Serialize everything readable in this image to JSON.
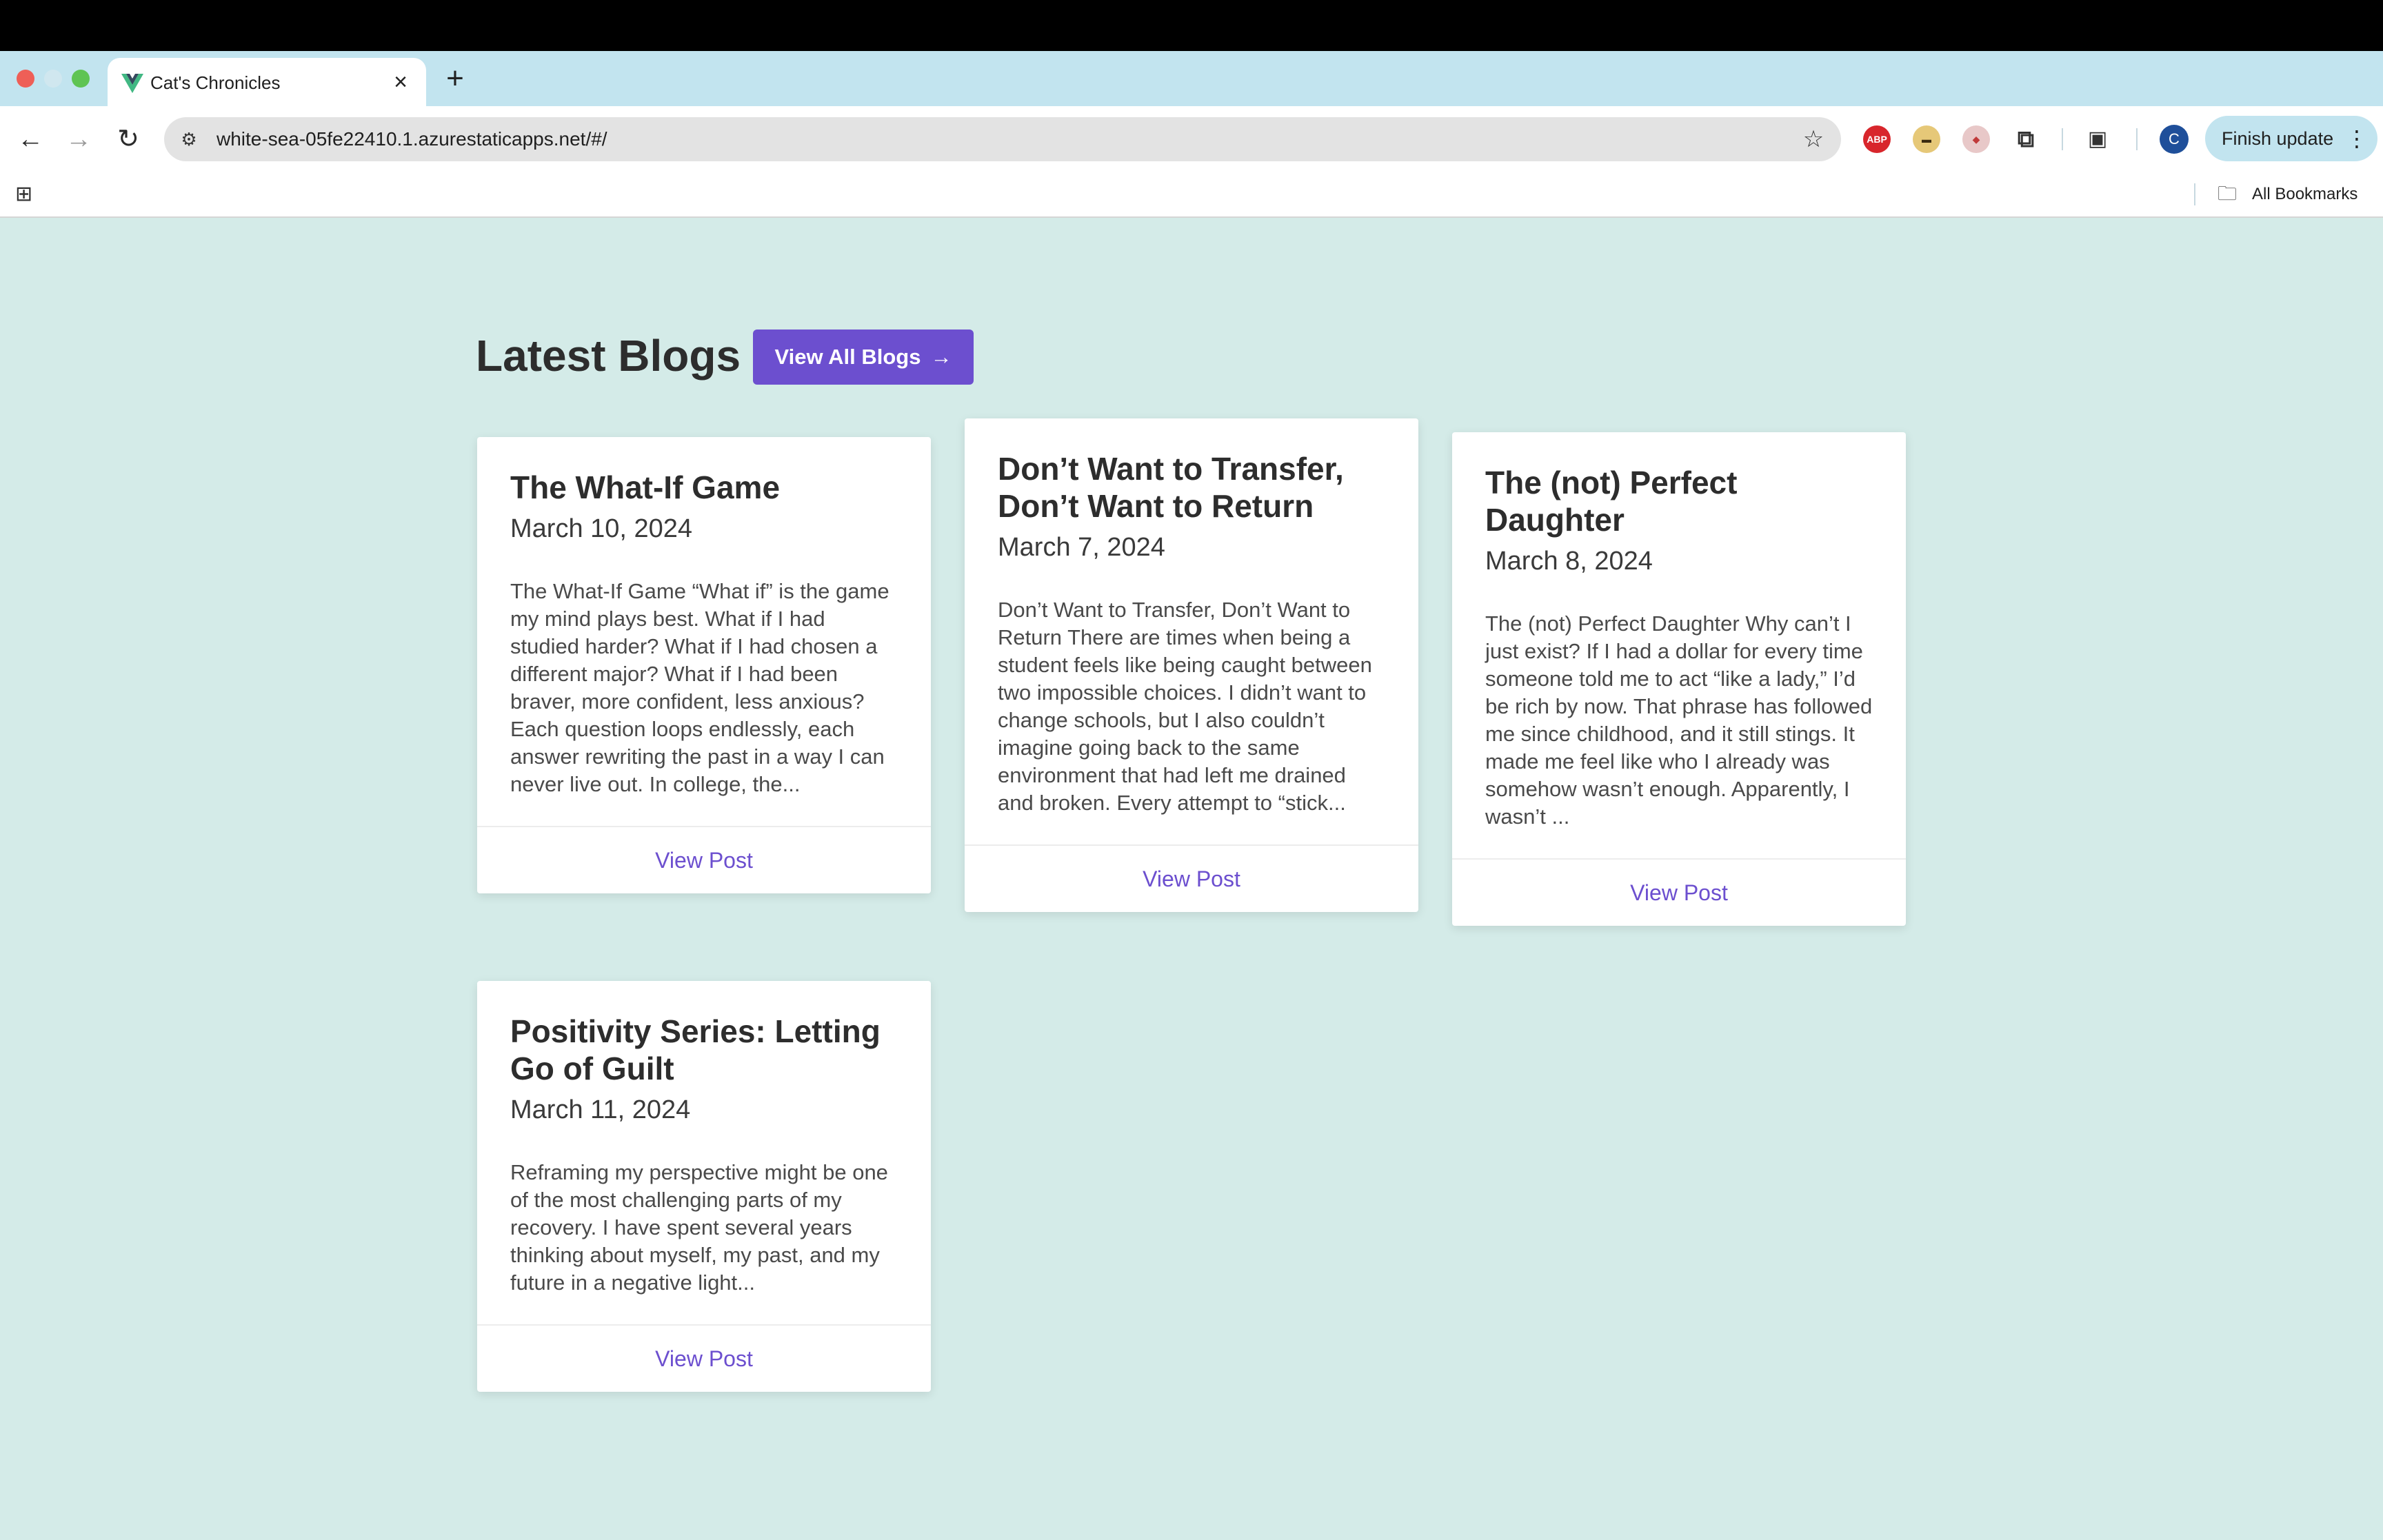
{
  "browser": {
    "tab_title": "Cat's Chronicles",
    "tab_close": "×",
    "new_tab": "+",
    "url": "white-sea-05fe22410.1.azurestaticapps.net/#/",
    "back": "←",
    "forward": "→",
    "reload": "↻",
    "site_info_icon": "⚙",
    "star": "☆",
    "extensions": {
      "abp": "ABP",
      "plant": "▬",
      "shield": "◆",
      "puzzle": "⧉",
      "media": "▣"
    },
    "avatar_letter": "C",
    "finish_update_label": "Finish update",
    "menu": "⋮",
    "apps_icon": "⊞",
    "bookmarks_folder_icon": "🗀",
    "all_bookmarks_label": "All Bookmarks"
  },
  "page": {
    "heading": "Latest Blogs",
    "view_all_label": "View All Blogs",
    "view_all_arrow": "→"
  },
  "posts": [
    {
      "title": "The What-If Game",
      "date": "March 10, 2024",
      "excerpt": "The What-If Game “What if” is the game my mind plays best. What if I had studied harder? What if I had chosen a different major? What if I had been braver, more confident, less anxious? Each question loops endlessly, each answer rewriting the past in a way I can never live out. In college, the...",
      "link_label": "View Post"
    },
    {
      "title": "Don’t Want to Transfer, Don’t Want to Return",
      "date": "March 7, 2024",
      "excerpt": "Don’t Want to Transfer, Don’t Want to Return There are times when being a student feels like being caught between two impossible choices. I didn’t want to change schools, but I also couldn’t imagine going back to the same environment that had left me drained and broken. Every attempt to “stick...",
      "link_label": "View Post"
    },
    {
      "title": "The (not) Perfect Daughter",
      "date": "March 8, 2024",
      "excerpt": "The (not) Perfect Daughter Why can’t I just exist? If I had a dollar for every time someone told me to act “like a lady,” I’d be rich by now. That phrase has followed me since childhood, and it still stings. It made me feel like who I already was somehow wasn’t enough. Apparently, I wasn’t ...",
      "link_label": "View Post"
    },
    {
      "title": "Positivity Series: Letting Go of Guilt",
      "date": "March 11, 2024",
      "excerpt": "Reframing my perspective might be one of the most challenging parts of my recovery. I have spent several years thinking about myself, my past, and my future in a negative light...",
      "link_label": "View Post"
    }
  ],
  "colors": {
    "page_background": "#d4ebe8",
    "accent": "#6c4fcf",
    "tabstrip": "#c2e4ef"
  }
}
